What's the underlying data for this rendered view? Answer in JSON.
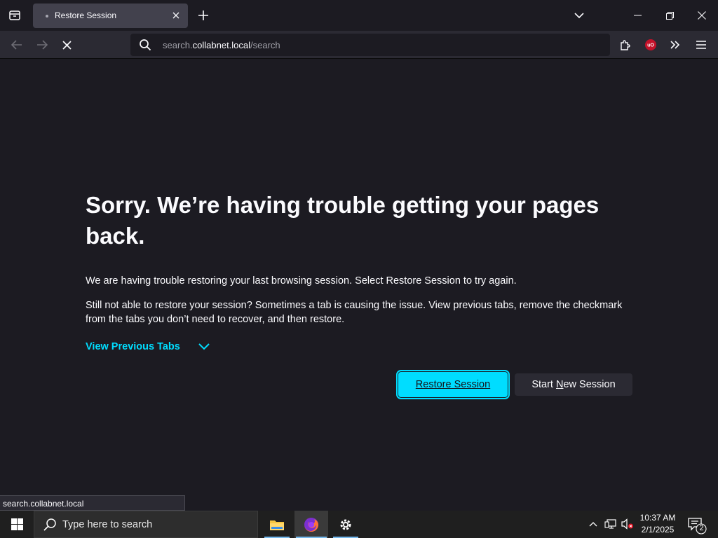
{
  "tab": {
    "title": "Restore Session"
  },
  "urlbar": {
    "prefix": "search.",
    "host": "collabnet.local",
    "path": "/search"
  },
  "page": {
    "headline": "Sorry. We’re having trouble getting your pages back.",
    "paragraph1": "We are having trouble restoring your last browsing session. Select Restore Session to try again.",
    "paragraph2": "Still not able to restore your session? Sometimes a tab is causing the issue. View previous tabs, remove the checkmark from the tabs you don’t need to recover, and then restore.",
    "view_previous_tabs": "View Previous Tabs",
    "restore_button": "Restore Session",
    "start_new_prefix": "Start ",
    "start_new_mnemonic": "N",
    "start_new_suffix": "ew Session"
  },
  "status_text": "search.collabnet.local",
  "taskbar": {
    "search_placeholder": "Type here to search",
    "time": "10:37 AM",
    "date": "2/1/2025",
    "notification_count": "2"
  },
  "colors": {
    "accent": "#00ddff",
    "background": "#1c1b22",
    "toolbar": "#2b2a33"
  }
}
